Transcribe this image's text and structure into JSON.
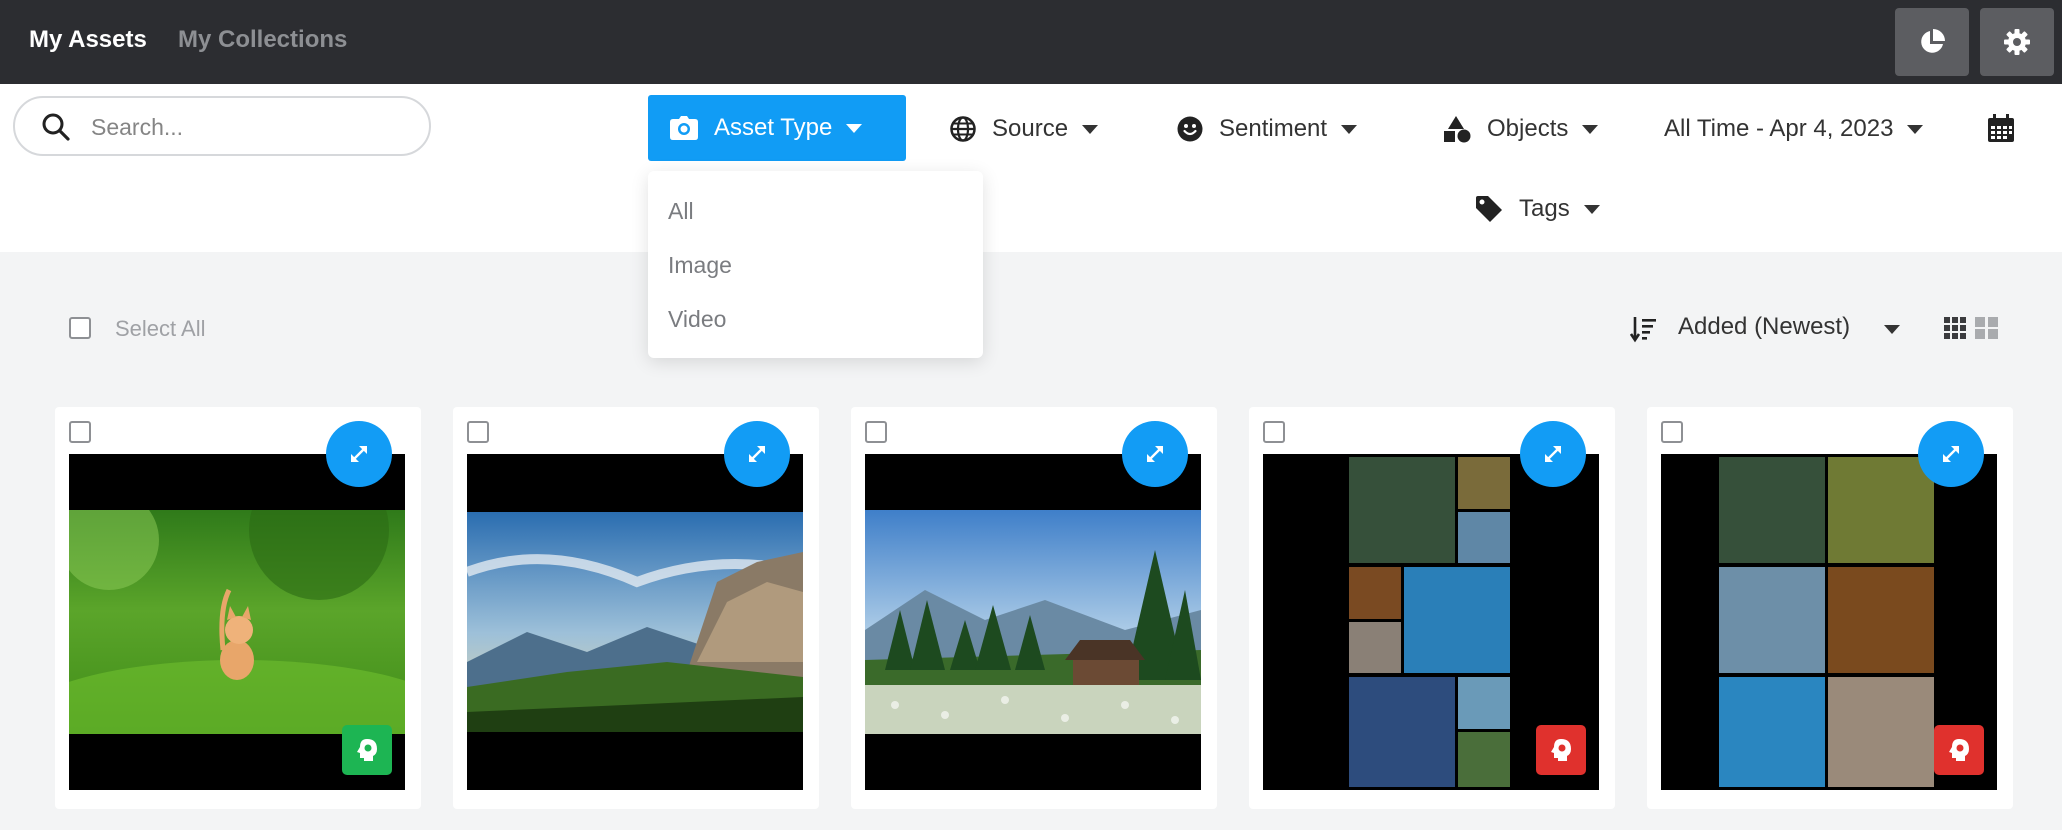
{
  "nav": {
    "tabs": [
      {
        "label": "My Assets"
      },
      {
        "label": "My Collections"
      }
    ]
  },
  "search": {
    "placeholder": "Search..."
  },
  "filters": {
    "asset_type": "Asset Type",
    "source": "Source",
    "sentiment": "Sentiment",
    "objects": "Objects",
    "date_range": "All Time - Apr 4, 2023",
    "tags": "Tags"
  },
  "asset_type_menu": {
    "options": [
      "All",
      "Image",
      "Video"
    ]
  },
  "toolbar": {
    "select_all": "Select All",
    "sort": "Added (Newest)"
  },
  "colors": {
    "accent": "#119cf5",
    "positive": "#1db553",
    "negative": "#e0312d"
  },
  "icons": {
    "stats": "pie-chart-icon",
    "settings": "gear-icon",
    "search": "search-icon",
    "asset_type": "camera-icon",
    "source": "globe-icon",
    "sentiment": "smiley-icon",
    "objects": "shapes-icon",
    "date": "calendar-icon",
    "tags": "tag-icon",
    "sort": "sort-descending-icon",
    "view": "grid-view-icon",
    "expand": "expand-icon",
    "sentiment_badge": "head-icon"
  },
  "assets": [
    {
      "sentiment": "positive"
    },
    {
      "sentiment": "none"
    },
    {
      "sentiment": "none"
    },
    {
      "sentiment": "negative"
    },
    {
      "sentiment": "negative"
    }
  ]
}
